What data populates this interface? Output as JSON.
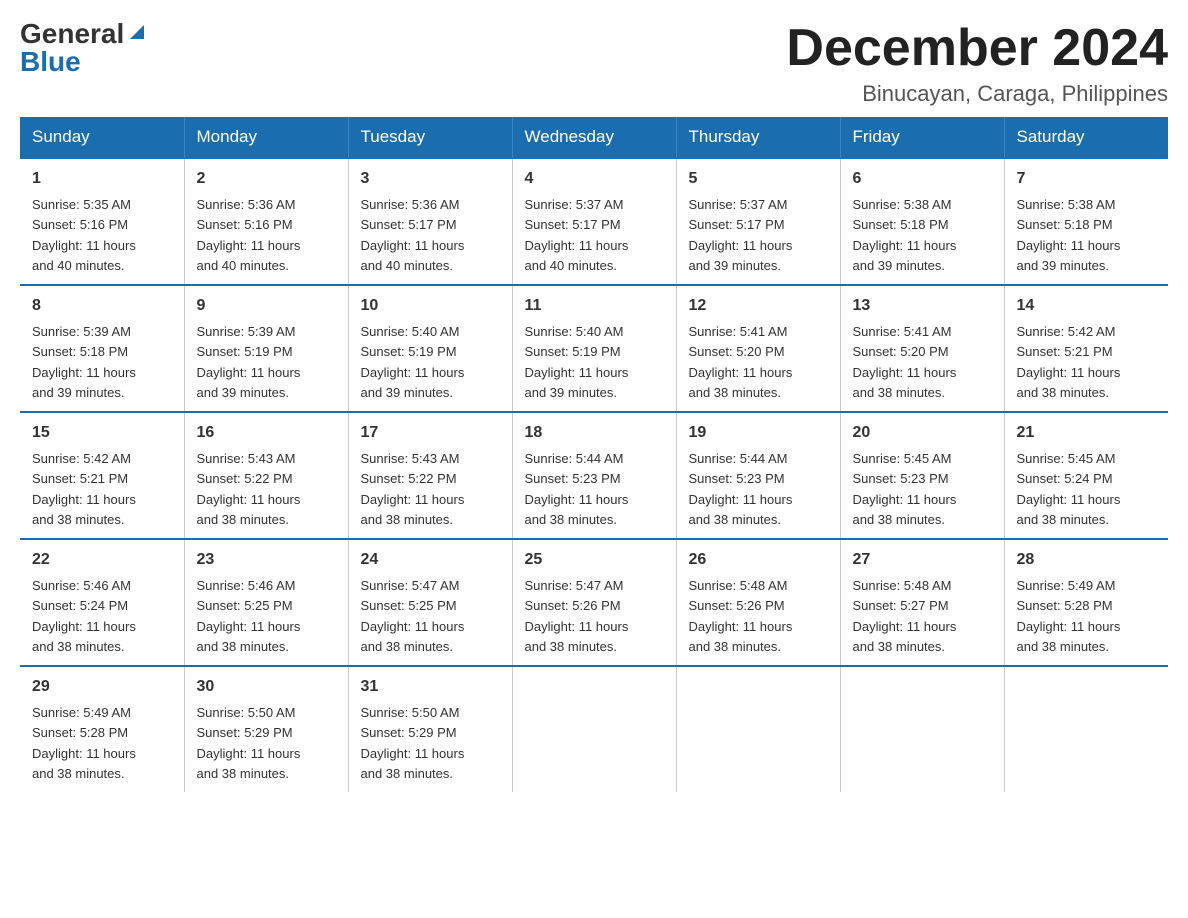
{
  "logo": {
    "general": "General",
    "blue": "Blue"
  },
  "header": {
    "month": "December 2024",
    "location": "Binucayan, Caraga, Philippines"
  },
  "weekdays": [
    "Sunday",
    "Monday",
    "Tuesday",
    "Wednesday",
    "Thursday",
    "Friday",
    "Saturday"
  ],
  "weeks": [
    [
      {
        "day": "1",
        "sunrise": "5:35 AM",
        "sunset": "5:16 PM",
        "daylight": "11 hours and 40 minutes."
      },
      {
        "day": "2",
        "sunrise": "5:36 AM",
        "sunset": "5:16 PM",
        "daylight": "11 hours and 40 minutes."
      },
      {
        "day": "3",
        "sunrise": "5:36 AM",
        "sunset": "5:17 PM",
        "daylight": "11 hours and 40 minutes."
      },
      {
        "day": "4",
        "sunrise": "5:37 AM",
        "sunset": "5:17 PM",
        "daylight": "11 hours and 40 minutes."
      },
      {
        "day": "5",
        "sunrise": "5:37 AM",
        "sunset": "5:17 PM",
        "daylight": "11 hours and 39 minutes."
      },
      {
        "day": "6",
        "sunrise": "5:38 AM",
        "sunset": "5:18 PM",
        "daylight": "11 hours and 39 minutes."
      },
      {
        "day": "7",
        "sunrise": "5:38 AM",
        "sunset": "5:18 PM",
        "daylight": "11 hours and 39 minutes."
      }
    ],
    [
      {
        "day": "8",
        "sunrise": "5:39 AM",
        "sunset": "5:18 PM",
        "daylight": "11 hours and 39 minutes."
      },
      {
        "day": "9",
        "sunrise": "5:39 AM",
        "sunset": "5:19 PM",
        "daylight": "11 hours and 39 minutes."
      },
      {
        "day": "10",
        "sunrise": "5:40 AM",
        "sunset": "5:19 PM",
        "daylight": "11 hours and 39 minutes."
      },
      {
        "day": "11",
        "sunrise": "5:40 AM",
        "sunset": "5:19 PM",
        "daylight": "11 hours and 39 minutes."
      },
      {
        "day": "12",
        "sunrise": "5:41 AM",
        "sunset": "5:20 PM",
        "daylight": "11 hours and 38 minutes."
      },
      {
        "day": "13",
        "sunrise": "5:41 AM",
        "sunset": "5:20 PM",
        "daylight": "11 hours and 38 minutes."
      },
      {
        "day": "14",
        "sunrise": "5:42 AM",
        "sunset": "5:21 PM",
        "daylight": "11 hours and 38 minutes."
      }
    ],
    [
      {
        "day": "15",
        "sunrise": "5:42 AM",
        "sunset": "5:21 PM",
        "daylight": "11 hours and 38 minutes."
      },
      {
        "day": "16",
        "sunrise": "5:43 AM",
        "sunset": "5:22 PM",
        "daylight": "11 hours and 38 minutes."
      },
      {
        "day": "17",
        "sunrise": "5:43 AM",
        "sunset": "5:22 PM",
        "daylight": "11 hours and 38 minutes."
      },
      {
        "day": "18",
        "sunrise": "5:44 AM",
        "sunset": "5:23 PM",
        "daylight": "11 hours and 38 minutes."
      },
      {
        "day": "19",
        "sunrise": "5:44 AM",
        "sunset": "5:23 PM",
        "daylight": "11 hours and 38 minutes."
      },
      {
        "day": "20",
        "sunrise": "5:45 AM",
        "sunset": "5:23 PM",
        "daylight": "11 hours and 38 minutes."
      },
      {
        "day": "21",
        "sunrise": "5:45 AM",
        "sunset": "5:24 PM",
        "daylight": "11 hours and 38 minutes."
      }
    ],
    [
      {
        "day": "22",
        "sunrise": "5:46 AM",
        "sunset": "5:24 PM",
        "daylight": "11 hours and 38 minutes."
      },
      {
        "day": "23",
        "sunrise": "5:46 AM",
        "sunset": "5:25 PM",
        "daylight": "11 hours and 38 minutes."
      },
      {
        "day": "24",
        "sunrise": "5:47 AM",
        "sunset": "5:25 PM",
        "daylight": "11 hours and 38 minutes."
      },
      {
        "day": "25",
        "sunrise": "5:47 AM",
        "sunset": "5:26 PM",
        "daylight": "11 hours and 38 minutes."
      },
      {
        "day": "26",
        "sunrise": "5:48 AM",
        "sunset": "5:26 PM",
        "daylight": "11 hours and 38 minutes."
      },
      {
        "day": "27",
        "sunrise": "5:48 AM",
        "sunset": "5:27 PM",
        "daylight": "11 hours and 38 minutes."
      },
      {
        "day": "28",
        "sunrise": "5:49 AM",
        "sunset": "5:28 PM",
        "daylight": "11 hours and 38 minutes."
      }
    ],
    [
      {
        "day": "29",
        "sunrise": "5:49 AM",
        "sunset": "5:28 PM",
        "daylight": "11 hours and 38 minutes."
      },
      {
        "day": "30",
        "sunrise": "5:50 AM",
        "sunset": "5:29 PM",
        "daylight": "11 hours and 38 minutes."
      },
      {
        "day": "31",
        "sunrise": "5:50 AM",
        "sunset": "5:29 PM",
        "daylight": "11 hours and 38 minutes."
      },
      null,
      null,
      null,
      null
    ]
  ],
  "labels": {
    "sunrise": "Sunrise:",
    "sunset": "Sunset:",
    "daylight": "Daylight:"
  }
}
